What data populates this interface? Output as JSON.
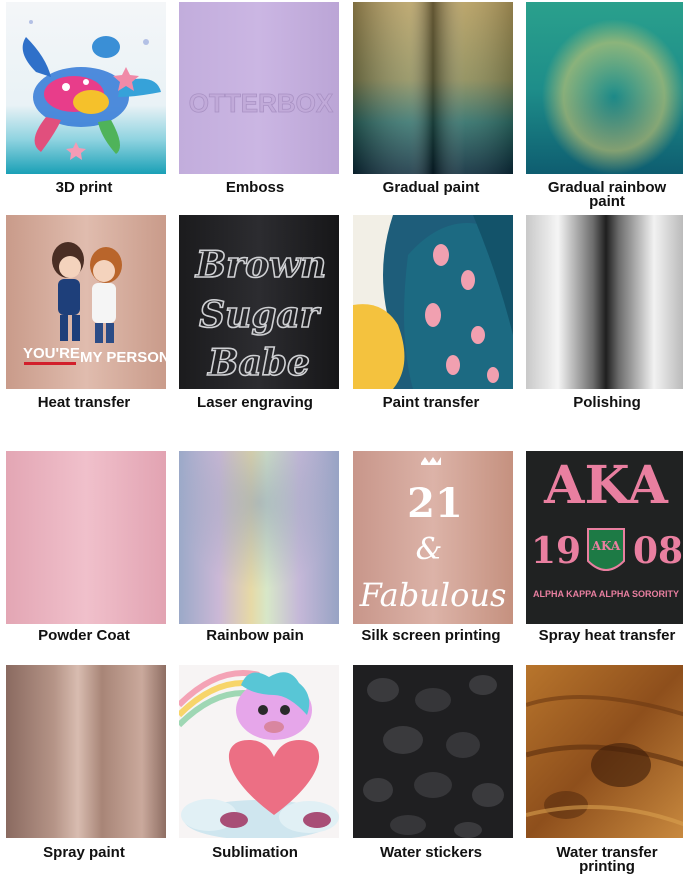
{
  "labels": {
    "3d_print": "3D print",
    "emboss": "Emboss",
    "gradual_paint": "Gradual paint",
    "gradual_rainbow_paint_l1": "Gradual rainbow",
    "gradual_rainbow_paint_l2": "paint",
    "heat_transfer": "Heat transfer",
    "laser_engraving": "Laser engraving",
    "paint_transfer": "Paint transfer",
    "polishing": "Polishing",
    "powder_coat": "Powder Coat",
    "rainbow_pain": "Rainbow pain",
    "silk_screen_printing": "Silk screen printing",
    "spray_heat_transfer": "Spray heat transfer",
    "spray_paint": "Spray paint",
    "sublimation": "Sublimation",
    "water_stickers": "Water stickers",
    "water_transfer_printing_l1": "Water transfer",
    "water_transfer_printing_l2": "printing"
  },
  "sample_text": {
    "emboss_logo": "OTTERBOX",
    "heat_transfer_caption_a": "YOU'RE",
    "heat_transfer_caption_b": "MY PERSON",
    "laser_line1": "Brown",
    "laser_line2": "Sugar",
    "laser_line3": "Babe",
    "silk_number": "21",
    "silk_amp": "&",
    "silk_word": "Fabulous",
    "aka_letters": "AKA",
    "aka_year_a": "19",
    "aka_year_b": "08",
    "aka_crest": "AKA",
    "aka_sub": "ALPHA KAPPA ALPHA SORORITY"
  },
  "colors": {
    "label_text": "#111111",
    "aka_pink": "#e97fa0",
    "aka_green": "#1d7a45"
  }
}
